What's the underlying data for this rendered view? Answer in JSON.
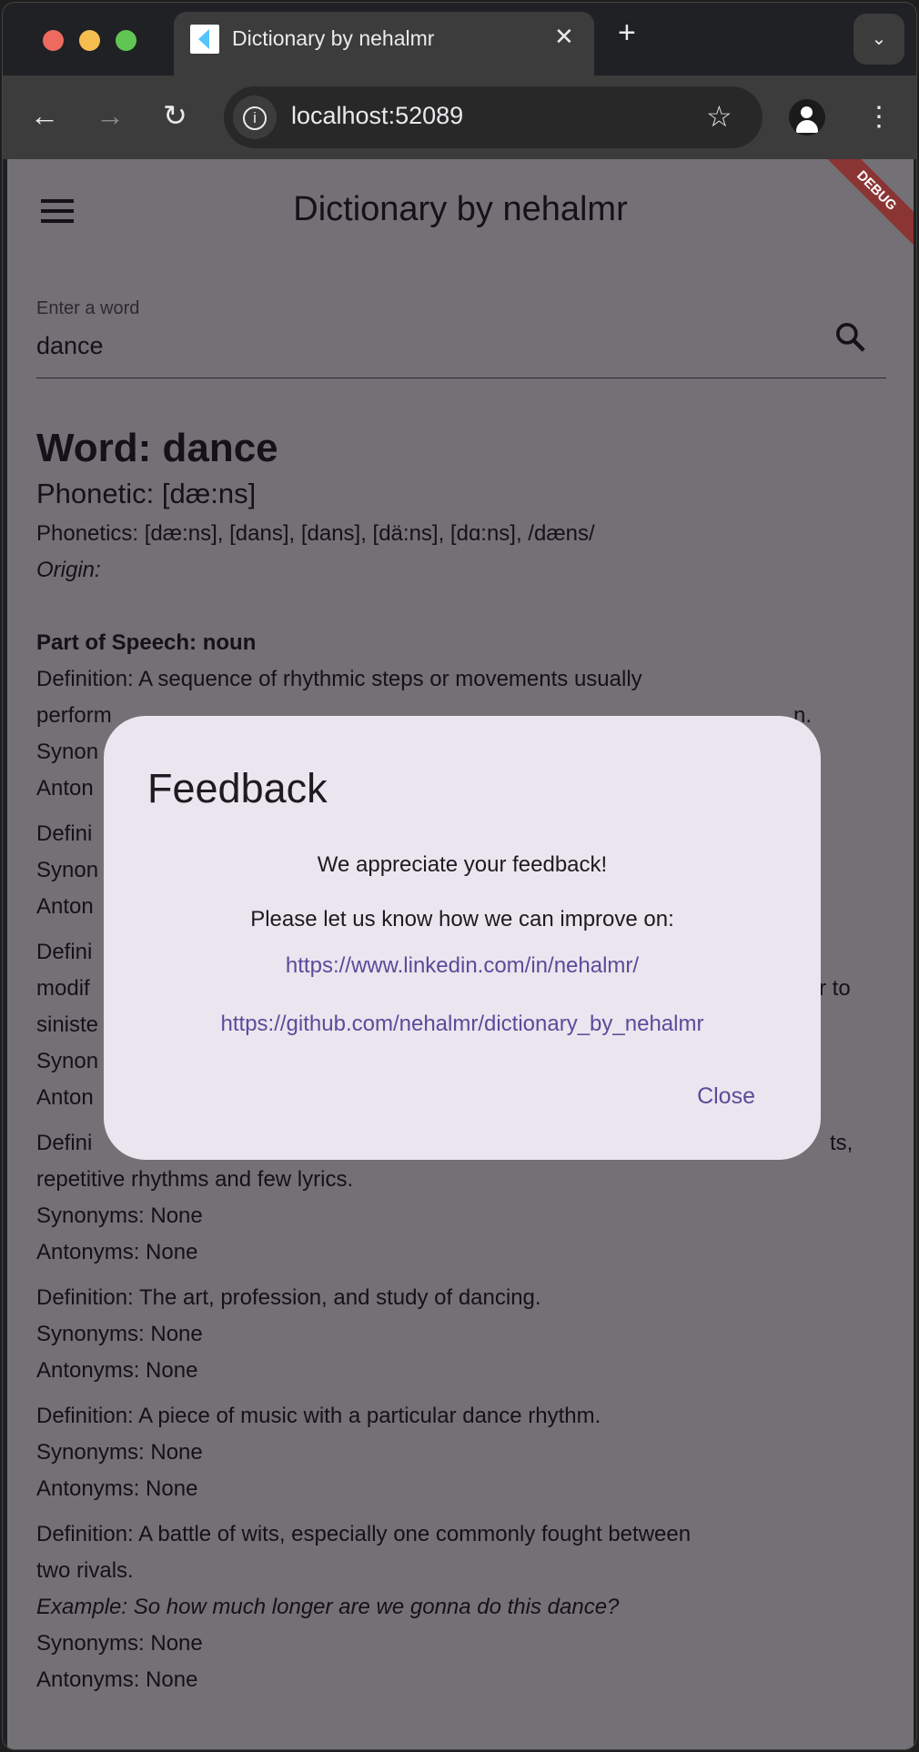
{
  "browser": {
    "tab_title": "Dictionary by nehalmr",
    "url": "localhost:52089"
  },
  "app": {
    "title": "Dictionary by nehalmr",
    "debug_banner": "DEBUG"
  },
  "search": {
    "label": "Enter a word",
    "value": "dance"
  },
  "entry": {
    "word": "Word: dance",
    "phonetic": "Phonetic: [dæ:ns]",
    "phonetics": "Phonetics: [dæ:ns], [dans], [dans], [dä:ns], [dɑ:ns], /dæns/",
    "origin": "Origin:",
    "part_of_speech": "Part of Speech: noun",
    "lines": {
      "d1a": "Definition: A sequence of rhythmic steps or movements usually",
      "d1b": "perform",
      "d1b_right": "n.",
      "d1s": "Synon",
      "d1n": "Anton",
      "d2": "Defini",
      "d2s": "Synon",
      "d2n": "Anton",
      "d3a": "Defini",
      "d3b": "modif",
      "d3b_right": "r to",
      "d3c": "siniste",
      "d3s": "Synon",
      "d3n": "Anton",
      "d4a": "Defini",
      "d4a_right": "ts,",
      "d4b": "repetitive rhythms and few lyrics.",
      "d4s": "Synonyms: None",
      "d4n": "Antonyms: None",
      "d5": "Definition: The art, profession, and study of dancing.",
      "d5s": "Synonyms: None",
      "d5n": "Antonyms: None",
      "d6": "Definition: A piece of music with a particular dance rhythm.",
      "d6s": "Synonyms: None",
      "d6n": "Antonyms: None",
      "d7a": "Definition: A battle of wits, especially one commonly fought between",
      "d7b": "two rivals.",
      "d7ex": "Example: So how much longer are we gonna do this dance?",
      "d7s": "Synonyms: None",
      "d7n": "Antonyms: None"
    }
  },
  "dialog": {
    "title": "Feedback",
    "line1": "We appreciate your feedback!",
    "line2": "Please let us know how we can improve on:",
    "link1": "https://www.linkedin.com/in/nehalmr/",
    "link2": "https://github.com/nehalmr/dictionary_by_nehalmr",
    "close": "Close"
  }
}
